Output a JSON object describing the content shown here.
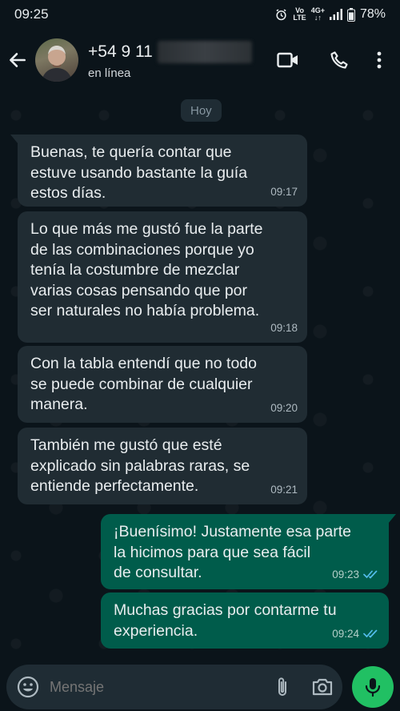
{
  "status_bar": {
    "time": "09:25",
    "network_top": "Vo",
    "network_bottom": "LTE",
    "signal_top": "4G+",
    "battery": "78%"
  },
  "header": {
    "phone_prefix": "+54 9 11",
    "status": "en línea",
    "icons": [
      "back-arrow-icon",
      "video-call-icon",
      "phone-icon",
      "more-vert-icon"
    ]
  },
  "chat": {
    "date_chip": "Hoy",
    "messages": [
      {
        "direction": "in",
        "text": "Buenas, te quería contar que\nestuve usando bastante la guía\nestos días.",
        "time": "09:17"
      },
      {
        "direction": "in",
        "text": "Lo que más me gustó fue la parte\nde las combinaciones porque yo\ntenía la costumbre de mezclar\nvarias cosas pensando que por\nser naturales no había problema.",
        "time": "09:18"
      },
      {
        "direction": "in",
        "text": "Con la tabla entendí que no todo\nse puede combinar de cualquier\nmanera.",
        "time": "09:20"
      },
      {
        "direction": "in",
        "text": "También me gustó que esté\nexplicado sin palabras raras, se\nentiende perfectamente.",
        "time": "09:21"
      },
      {
        "direction": "out",
        "text": "¡Buenísimo! Justamente esa parte\nla hicimos para que sea fácil\nde consultar.",
        "time": "09:23",
        "read": true
      },
      {
        "direction": "out",
        "text": "Muchas gracias por contarme tu\nexperiencia.",
        "time": "09:24",
        "read": true
      }
    ]
  },
  "composer": {
    "placeholder": "Mensaje"
  },
  "colors": {
    "background": "#0b141a",
    "incoming_bubble": "#202c33",
    "outgoing_bubble": "#005c4b",
    "read_ticks": "#53bdeb",
    "mic_button": "#21c063"
  }
}
